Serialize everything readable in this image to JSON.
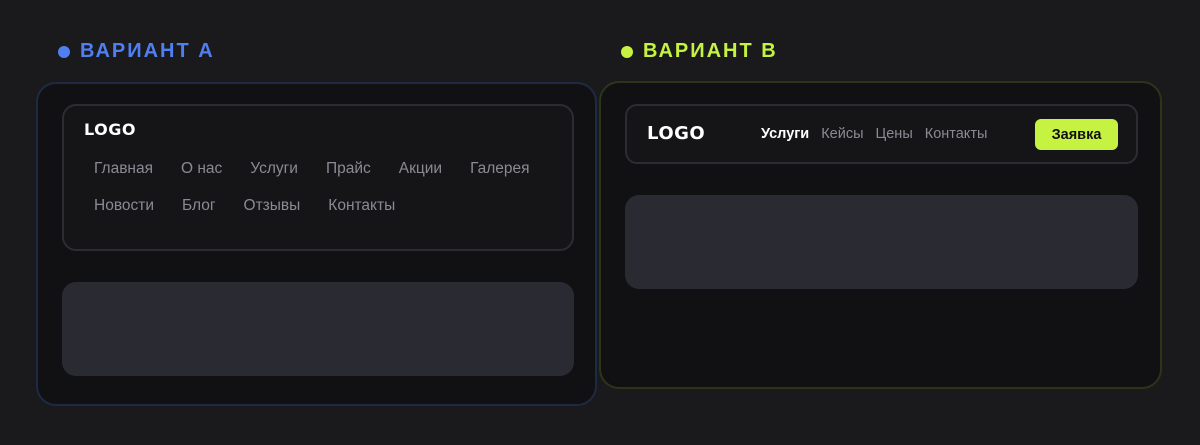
{
  "variant_a": {
    "title": "ВАРИАНТ А",
    "accent": "#4f7ff0",
    "logo": "LOGO",
    "menu": [
      "Главная",
      "О нас",
      "Услуги",
      "Прайс",
      "Акции",
      "Галерея",
      "Новости",
      "Блог",
      "Отзывы",
      "Контакты"
    ]
  },
  "variant_b": {
    "title": "ВАРИАНТ В",
    "accent": "#c6f341",
    "logo": "LOGO",
    "nav": [
      "Услуги",
      "Кейсы",
      "Цены",
      "Контакты"
    ],
    "active_nav": "Услуги",
    "cta_label": "Заявка"
  }
}
